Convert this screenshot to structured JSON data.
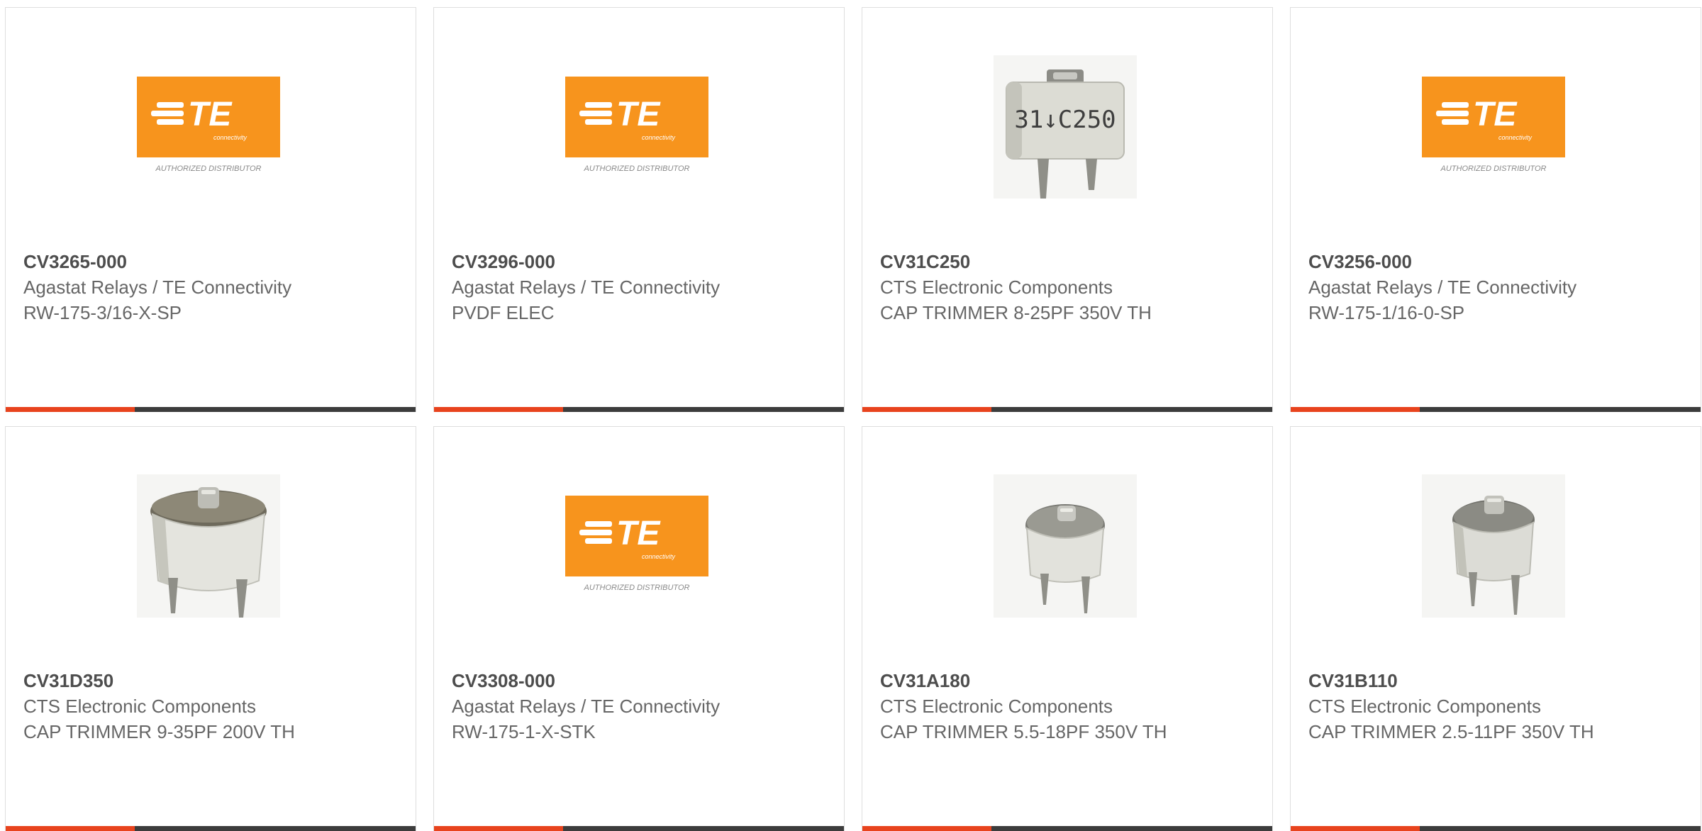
{
  "colors": {
    "te_orange": "#f7941d",
    "card_bar": "#3c3c3c",
    "card_accent": "#e8431d",
    "text": "#666666",
    "part_number": "#4d4d4d"
  },
  "te_logo": {
    "wordmark": "TE",
    "tagline": "connectivity",
    "caption": "AUTHORIZED DISTRIBUTOR"
  },
  "products": [
    {
      "part_number": "CV3265-000",
      "manufacturer": "Agastat Relays / TE Connectivity",
      "description": "RW-175-3/16-X-SP",
      "image": "te-authorized-distributor-logo"
    },
    {
      "part_number": "CV3296-000",
      "manufacturer": "Agastat Relays / TE Connectivity",
      "description": "PVDF ELEC",
      "image": "te-authorized-distributor-logo"
    },
    {
      "part_number": "CV31C250",
      "manufacturer": "CTS Electronic Components",
      "description": "CAP TRIMMER 8-25PF 350V TH",
      "image": "trimmer-capacitor-photo",
      "image_marking": "31↓C250"
    },
    {
      "part_number": "CV3256-000",
      "manufacturer": "Agastat Relays / TE Connectivity",
      "description": "RW-175-1/16-0-SP",
      "image": "te-authorized-distributor-logo"
    },
    {
      "part_number": "CV31D350",
      "manufacturer": "CTS Electronic Components",
      "description": "CAP TRIMMER 9-35PF 200V TH",
      "image": "trimmer-capacitor-photo"
    },
    {
      "part_number": "CV3308-000",
      "manufacturer": "Agastat Relays / TE Connectivity",
      "description": "RW-175-1-X-STK",
      "image": "te-authorized-distributor-logo"
    },
    {
      "part_number": "CV31A180",
      "manufacturer": "CTS Electronic Components",
      "description": "CAP TRIMMER 5.5-18PF 350V TH",
      "image": "trimmer-capacitor-photo"
    },
    {
      "part_number": "CV31B110",
      "manufacturer": "CTS Electronic Components",
      "description": "CAP TRIMMER 2.5-11PF 350V TH",
      "image": "trimmer-capacitor-photo"
    }
  ]
}
